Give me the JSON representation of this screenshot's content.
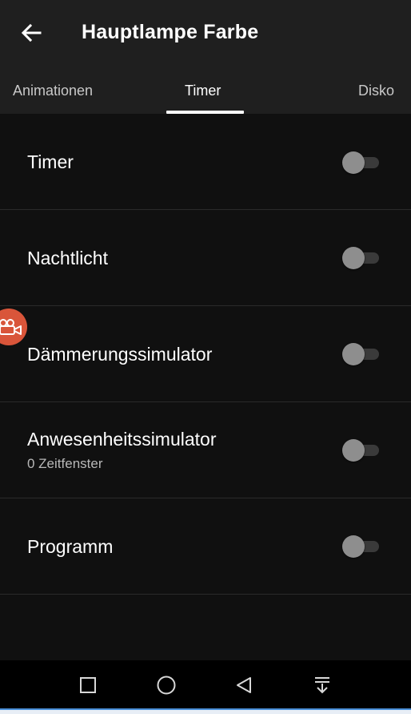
{
  "appbar": {
    "title": "Hauptlampe Farbe",
    "back_icon": "arrow-left-icon"
  },
  "tabs": [
    {
      "label": "Animationen",
      "active": false
    },
    {
      "label": "Timer",
      "active": true
    },
    {
      "label": "Disko",
      "active": false
    }
  ],
  "rows": [
    {
      "label": "Timer",
      "sub": "",
      "enabled": false
    },
    {
      "label": "Nachtlicht",
      "sub": "",
      "enabled": false
    },
    {
      "label": "Dämmerungssimulator",
      "sub": "",
      "enabled": false
    },
    {
      "label": "Anwesenheitssimulator",
      "sub": "0 Zeitfenster",
      "enabled": false
    },
    {
      "label": "Programm",
      "sub": "",
      "enabled": false
    }
  ],
  "overlay": {
    "icon": "video-camera-icon",
    "color": "#d9553a"
  },
  "navbar": {
    "icons": [
      "recents-square-icon",
      "home-circle-icon",
      "back-triangle-icon",
      "notification-pull-icon"
    ]
  },
  "colors": {
    "appbar_bg": "#1f1f1f",
    "list_bg": "#101010",
    "divider": "#2a2a2a",
    "switch_off_thumb": "#8e8e8e"
  }
}
